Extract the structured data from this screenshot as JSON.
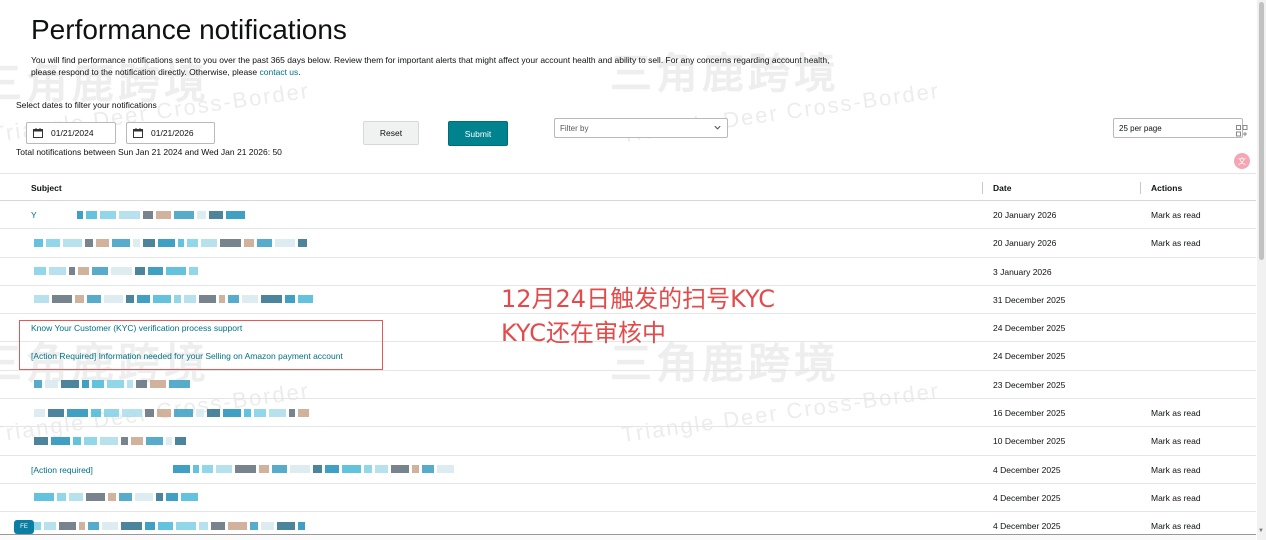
{
  "page": {
    "title": "Performance notifications",
    "intro_text": "You will find performance notifications sent to you over the past 365 days below. Review them for important alerts that might affect your account health and ability to sell. For any concerns regarding account health, please respond to the notification directly. Otherwise, please ",
    "intro_link": "contact us",
    "intro_end": "."
  },
  "filters": {
    "label": "Select dates to filter your notifications",
    "start_date": "01/21/2024",
    "end_date": "01/21/2026",
    "reset_label": "Reset",
    "submit_label": "Submit",
    "filter_by_placeholder": "Filter by",
    "per_page": "25 per page",
    "total_text": "Total notifications between Sun Jan 21 2024 and Wed Jan 21 2026: 50"
  },
  "table": {
    "headers": {
      "subject": "Subject",
      "date": "Date",
      "actions": "Actions"
    },
    "rows": [
      {
        "subject": "Y",
        "date": "20 January 2026",
        "action": "Mark as read",
        "masked": true
      },
      {
        "subject": "",
        "date": "20 January 2026",
        "action": "Mark as read",
        "masked": true
      },
      {
        "subject": "",
        "date": "3 January 2026",
        "action": "",
        "masked": true
      },
      {
        "subject": "",
        "date": "31 December 2025",
        "action": "",
        "masked": true
      },
      {
        "subject": "Know Your Customer (KYC) verification process support",
        "date": "24 December 2025",
        "action": "",
        "masked": false
      },
      {
        "subject": "[Action Required] Information needed for your Selling on Amazon payment account",
        "date": "24 December 2025",
        "action": "",
        "masked": false
      },
      {
        "subject": "",
        "date": "23 December 2025",
        "action": "",
        "masked": true
      },
      {
        "subject": "",
        "date": "16 December 2025",
        "action": "Mark as read",
        "masked": true
      },
      {
        "subject": "",
        "date": "10 December 2025",
        "action": "Mark as read",
        "masked": true
      },
      {
        "subject": "[Action required]",
        "date": "4 December 2025",
        "action": "Mark as read",
        "masked": true
      },
      {
        "subject": "",
        "date": "4 December 2025",
        "action": "Mark as read",
        "masked": true
      },
      {
        "subject": "",
        "date": "4 December 2025",
        "action": "Mark as read",
        "masked": true
      }
    ]
  },
  "annotation": {
    "line1": "12月24日触发的扫号KYC",
    "line2": "KYC还在审核中",
    "color": "#e34b4b"
  },
  "watermark": {
    "brand_cn": "三角鹿跨境",
    "brand_en": "Triangle Deer Cross-Border"
  },
  "colors": {
    "link": "#007185",
    "submit_bg": "#00838f"
  },
  "icons": {
    "date": "calendar-icon",
    "select": "chevron-down-icon"
  }
}
